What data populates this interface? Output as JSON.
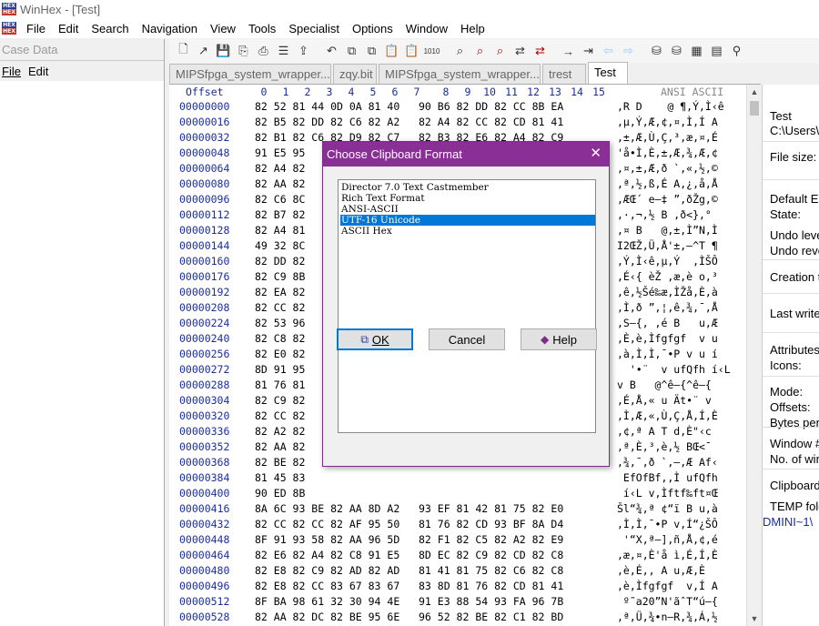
{
  "app": {
    "title": "WinHex - [Test]",
    "logo_top": "HEX",
    "logo_bottom": "HEX"
  },
  "menu": [
    "File",
    "Edit",
    "Search",
    "Navigation",
    "View",
    "Tools",
    "Specialist",
    "Options",
    "Window",
    "Help"
  ],
  "case_pane": {
    "title": "Case Data",
    "menu": [
      "File",
      "Edit"
    ]
  },
  "tabs": [
    {
      "label": "MIPSfpga_system_wrapper....",
      "active": false
    },
    {
      "label": "zqy.bit",
      "active": false
    },
    {
      "label": "MIPSfpga_system_wrapper....",
      "active": false
    },
    {
      "label": "trest",
      "active": false
    },
    {
      "label": "Test",
      "active": true
    }
  ],
  "editor": {
    "offset_header": "Offset",
    "col_headers": [
      "0",
      "1",
      "2",
      "3",
      "4",
      "5",
      "6",
      "7",
      "8",
      "9",
      "10",
      "11",
      "12",
      "13",
      "14",
      "15"
    ],
    "ansi_header": "ANSI ASCII",
    "rows": [
      {
        "off": "00000000",
        "hex": "82 52 81 44 0D 0A 81 40   90 B6 82 DD 82 CC 8B EA",
        "ansi": ",R D    @ ¶,Ý,Ì‹ê"
      },
      {
        "off": "00000016",
        "hex": "82 B5 82 DD 82 C6 82 A2   82 A4 82 CC 82 CD 81 41",
        "ansi": ",µ,Ý,Æ,¢,¤,Ì,Í A"
      },
      {
        "off": "00000032",
        "hex": "82 B1 82 C6 82 D9 82 C7   82 B3 82 E6 82 A4 82 C9",
        "ansi": ",±,Æ,Ù,Ç,³,æ,¤,É"
      },
      {
        "off": "00000048",
        "hex": "91 E5 95                                          ",
        "ansi": "'å•Ì,È,±,Æ,¾,Æ,¢"
      },
      {
        "off": "00000064",
        "hex": "82 A4 82                                          ",
        "ansi": ",¤,±,Æ,ð `,«,½,©"
      },
      {
        "off": "00000080",
        "hex": "82 AA 82                                          ",
        "ansi": ",ª,½,ß,É A,¿,å,Å"
      },
      {
        "off": "00000096",
        "hex": "82 C6 8C                                          ",
        "ansi": ",ÆŒ´ e–‡ ”,ðŽg,©"
      },
      {
        "off": "00000112",
        "hex": "82 B7 82                                          ",
        "ansi": ",·,¬,½ B ,ð<},°"
      },
      {
        "off": "00000128",
        "hex": "82 A4 81                                          ",
        "ansi": ",¤ B   @,±,Ì”N,Ì"
      },
      {
        "off": "00000144",
        "hex": "49 32 8C                                          ",
        "ansi": "I2ŒŽ,Ü,Å'±,–^T ¶"
      },
      {
        "off": "00000160",
        "hex": "82 DD 82                                          ",
        "ansi": ",Ý,Ì‹ê,µ,Ý  ,ÌŠÔ"
      },
      {
        "off": "00000176",
        "hex": "82 C9 8B                                          ",
        "ansi": ",É‹{ èŽ ,æ,è o,³"
      },
      {
        "off": "00000192",
        "hex": "82 EA 82                                          ",
        "ansi": ",ê,½Šé‰æ,ÌŽå,È,à"
      },
      {
        "off": "00000208",
        "hex": "82 CC 82                                          ",
        "ansi": ",Ì,ð ”,¦,ê,¾,¯,Å"
      },
      {
        "off": "00000224",
        "hex": "82 53 96                                          ",
        "ansi": ",S–{, ,é B   u,Æ"
      },
      {
        "off": "00000240",
        "hex": "82 C8 82                                          ",
        "ansi": ",È,è,Ìfgfgf  v u"
      },
      {
        "off": "00000256",
        "hex": "82 E0 82                                          ",
        "ansi": ",à,Ì,Ì,¯•P v u í"
      },
      {
        "off": "00000272",
        "hex": "8D 91 95                                          ",
        "ansi": "  '•¨  v ufQfh í‹L"
      },
      {
        "off": "00000288",
        "hex": "81 76 81                                          ",
        "ansi": "v B   @^ê–{^ê–{"
      },
      {
        "off": "00000304",
        "hex": "82 C9 82                                          ",
        "ansi": ",É,Å,« u Ät•¨ v"
      },
      {
        "off": "00000320",
        "hex": "82 CC 82                                          ",
        "ansi": ",Ì,Æ,«,Ù,Ç,Å,Í,È"
      },
      {
        "off": "00000336",
        "hex": "82 A2 82                                          ",
        "ansi": ",¢,ª A T d,È\"‹c"
      },
      {
        "off": "00000352",
        "hex": "82 AA 82                                          ",
        "ansi": ",ª,È,³,è,½ BŒ<¯"
      },
      {
        "off": "00000368",
        "hex": "82 BE 82                                          ",
        "ansi": ",¾,¯,ð `,–,Æ Af‹"
      },
      {
        "off": "00000384",
        "hex": "81 45 83                                          ",
        "ansi": " EfOfBf‚,Ì ufQfh"
      },
      {
        "off": "00000400",
        "hex": "90 ED 8B                                          ",
        "ansi": " í‹L v,Ìftf‰ft¤Œ"
      },
      {
        "off": "00000416",
        "hex": "8A 6C 93 BE 82 AA 8D A2   93 EF 81 42 81 75 82 E0",
        "ansi": "Šl“¾,ª ¢“ï B u,à"
      },
      {
        "off": "00000432",
        "hex": "82 CC 82 CC 82 AF 95 50   81 76 82 CD 93 BF 8A D4",
        "ansi": ",Ì,Ì,¯•P v,Í“¿ŠÔ"
      },
      {
        "off": "00000448",
        "hex": "8F 91 93 58 82 AA 96 5D   82 F1 82 C5 82 A2 82 E9",
        "ansi": " '“X,ª–],ñ,Å,¢,é"
      },
      {
        "off": "00000464",
        "hex": "82 E6 82 A4 82 C8 91 E5   8D EC 82 C9 82 CD 82 C8",
        "ansi": ",æ,¤,È'å ì,É,Í,È"
      },
      {
        "off": "00000480",
        "hex": "82 E8 82 C9 82 AD 82 AD   81 41 81 75 82 C6 82 C8",
        "ansi": ",è,É,­,­ A u,Æ,È"
      },
      {
        "off": "00000496",
        "hex": "82 E8 82 CC 83 67 83 67   83 8D 81 76 82 CD 81 41",
        "ansi": ",è,Ìfgfgf  v,Í A"
      },
      {
        "off": "00000512",
        "hex": "8F BA 98 61 32 30 94 4E   91 E3 88 54 93 FA 96 7B",
        "ansi": " º˜a20”N'ãˆT“ú–{"
      },
      {
        "off": "00000528",
        "hex": "82 AA 82 DC 82 BE 95 6E   96 52 82 BE 82 C1 82 BD",
        "ansi": ",ª,Ü,¾•n–R,¾,Á,½"
      }
    ]
  },
  "info_pane": {
    "items": [
      "Test",
      "C:\\Users\\",
      "File size:",
      "Default Ed",
      "State:",
      "Undo level",
      "Undo reve",
      "Creation t",
      "Last write",
      "Attributes",
      "Icons:",
      "Mode:",
      "Offsets:",
      "Bytes per",
      "Window #",
      "No. of win",
      "Clipboard",
      "TEMP fold"
    ],
    "path_fragment": "DMINI~1\\"
  },
  "dialog": {
    "title": "Choose Clipboard Format",
    "close": "✕",
    "options": [
      "Director 7.0 Text Castmember",
      "Rich Text Format",
      "ANSI-ASCII",
      "UTF-16 Unicode",
      "ASCII Hex"
    ],
    "selected_index": 3,
    "ok_label": "OK",
    "cancel_label": "Cancel",
    "help_label": "Help"
  }
}
